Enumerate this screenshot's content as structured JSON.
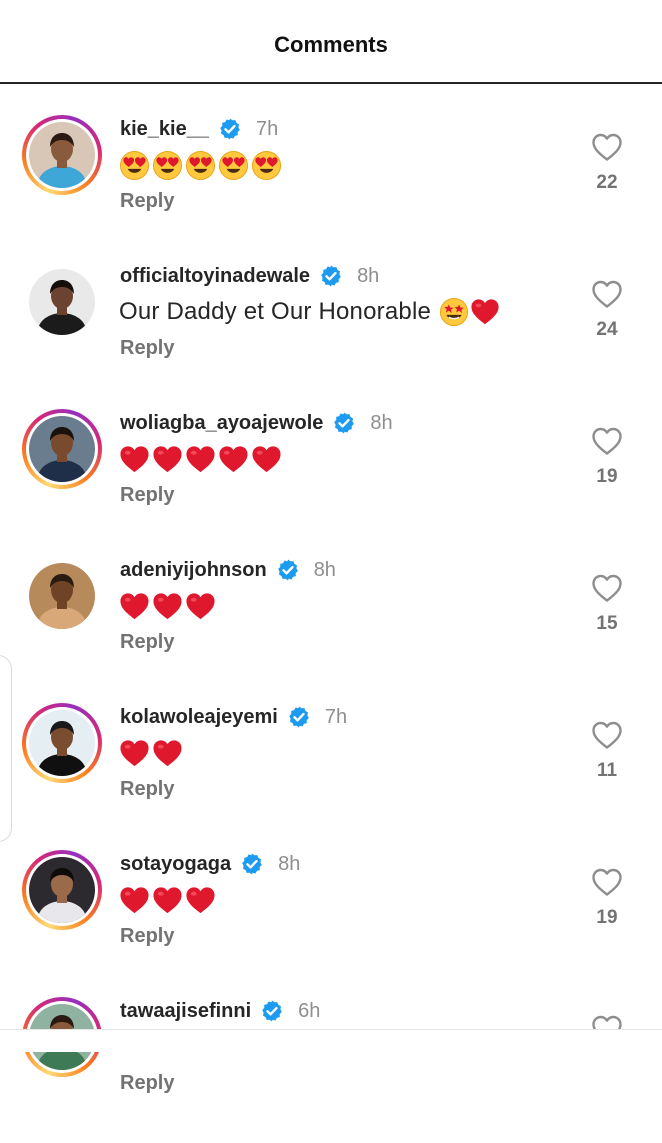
{
  "header": {
    "title": "Comments"
  },
  "reply_label": "Reply",
  "comments": [
    {
      "username": "kie_kie__",
      "time": "7h",
      "text": "",
      "emojis": [
        "heart-eyes",
        "heart-eyes",
        "heart-eyes",
        "heart-eyes",
        "heart-eyes"
      ],
      "likes": "22",
      "story_ring": true
    },
    {
      "username": "officialtoyinadewale",
      "time": "8h",
      "text": "Our Daddy et Our Honorable",
      "emojis": [
        "star-struck",
        "red-heart"
      ],
      "likes": "24",
      "story_ring": false
    },
    {
      "username": "woliagba_ayoajewole",
      "time": "8h",
      "text": "",
      "emojis": [
        "red-heart",
        "red-heart",
        "red-heart",
        "red-heart",
        "red-heart"
      ],
      "likes": "19",
      "story_ring": true
    },
    {
      "username": "adeniyijohnson",
      "time": "8h",
      "text": "",
      "emojis": [
        "red-heart",
        "red-heart",
        "red-heart"
      ],
      "likes": "15",
      "story_ring": false
    },
    {
      "username": "kolawoleajeyemi",
      "time": "7h",
      "text": "",
      "emojis": [
        "red-heart",
        "red-heart"
      ],
      "likes": "11",
      "story_ring": true
    },
    {
      "username": "sotayogaga",
      "time": "8h",
      "text": "",
      "emojis": [
        "red-heart",
        "red-heart",
        "red-heart"
      ],
      "likes": "19",
      "story_ring": true
    },
    {
      "username": "tawaajisefinni",
      "time": "6h",
      "text": "",
      "emojis": [],
      "likes": "",
      "story_ring": true
    }
  ],
  "colors": {
    "verified": "#1d9bf0",
    "meta": "#8e8e8e",
    "reply": "#737373",
    "heart": "#e0182d",
    "emoji_face": "#ffc83d"
  }
}
